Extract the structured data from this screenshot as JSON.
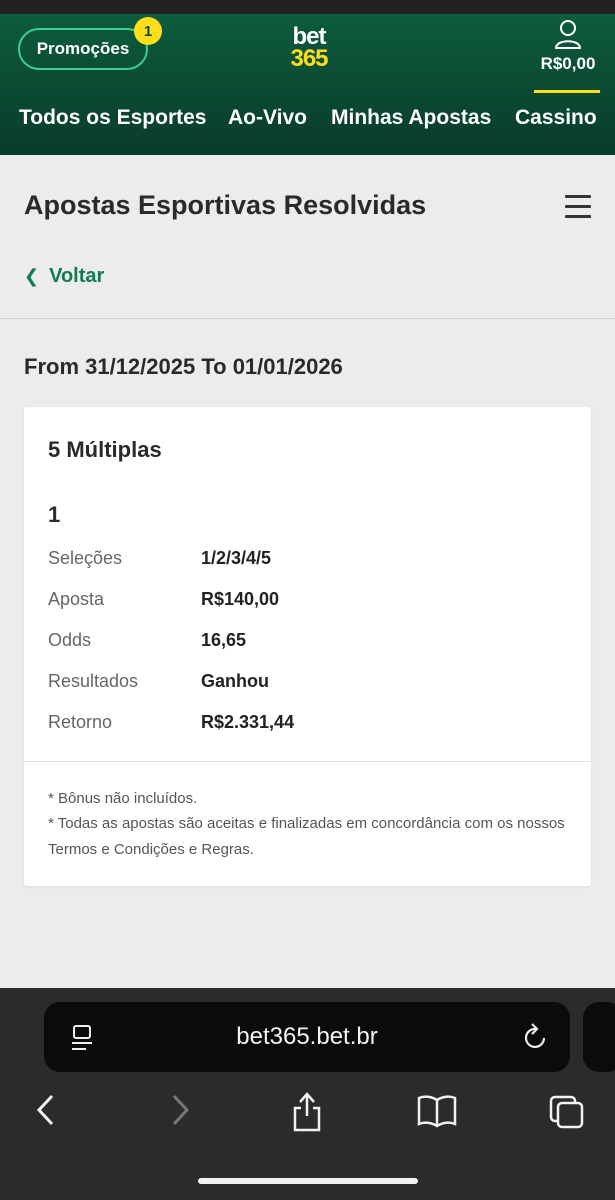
{
  "header": {
    "promo_label": "Promoções",
    "promo_badge": "1",
    "logo_top": "bet",
    "logo_bottom": "365",
    "balance": "R$0,00"
  },
  "nav": [
    {
      "label": "Todos os Esportes"
    },
    {
      "label": "Ao-Vivo"
    },
    {
      "label": "Minhas Apostas"
    },
    {
      "label": "Cassino"
    }
  ],
  "page": {
    "title": "Apostas Esportivas Resolvidas",
    "back_label": "Voltar",
    "date_range": "From 31/12/2025 To 01/01/2026"
  },
  "bet": {
    "type": "5 Múltiplas",
    "number": "1",
    "rows": [
      {
        "label": "Seleções",
        "value": "1/2/3/4/5"
      },
      {
        "label": "Aposta",
        "value": "R$140,00"
      },
      {
        "label": "Odds",
        "value": "16,65"
      },
      {
        "label": "Resultados",
        "value": "Ganhou"
      },
      {
        "label": "Retorno",
        "value": "R$2.331,44"
      }
    ],
    "notes": [
      "* Bônus não incluídos.",
      "* Todas as apostas são aceitas e finalizadas em concordância com os nossos Termos e Condições e Regras."
    ]
  },
  "browser": {
    "url": "bet365.bet.br"
  },
  "icons": {
    "account": "person-icon",
    "menu": "hamburger-menu-icon",
    "back": "chevron-left-icon",
    "reader": "reader-mode-icon",
    "reload": "reload-icon",
    "browser_back": "back-arrow-icon",
    "browser_forward": "forward-arrow-icon",
    "share": "share-icon",
    "bookmarks": "bookmarks-icon",
    "tabs": "tabs-icon"
  },
  "colors": {
    "header_green": "#0b4a32",
    "accent_yellow": "#ffdf1b",
    "link_green": "#147a50"
  }
}
